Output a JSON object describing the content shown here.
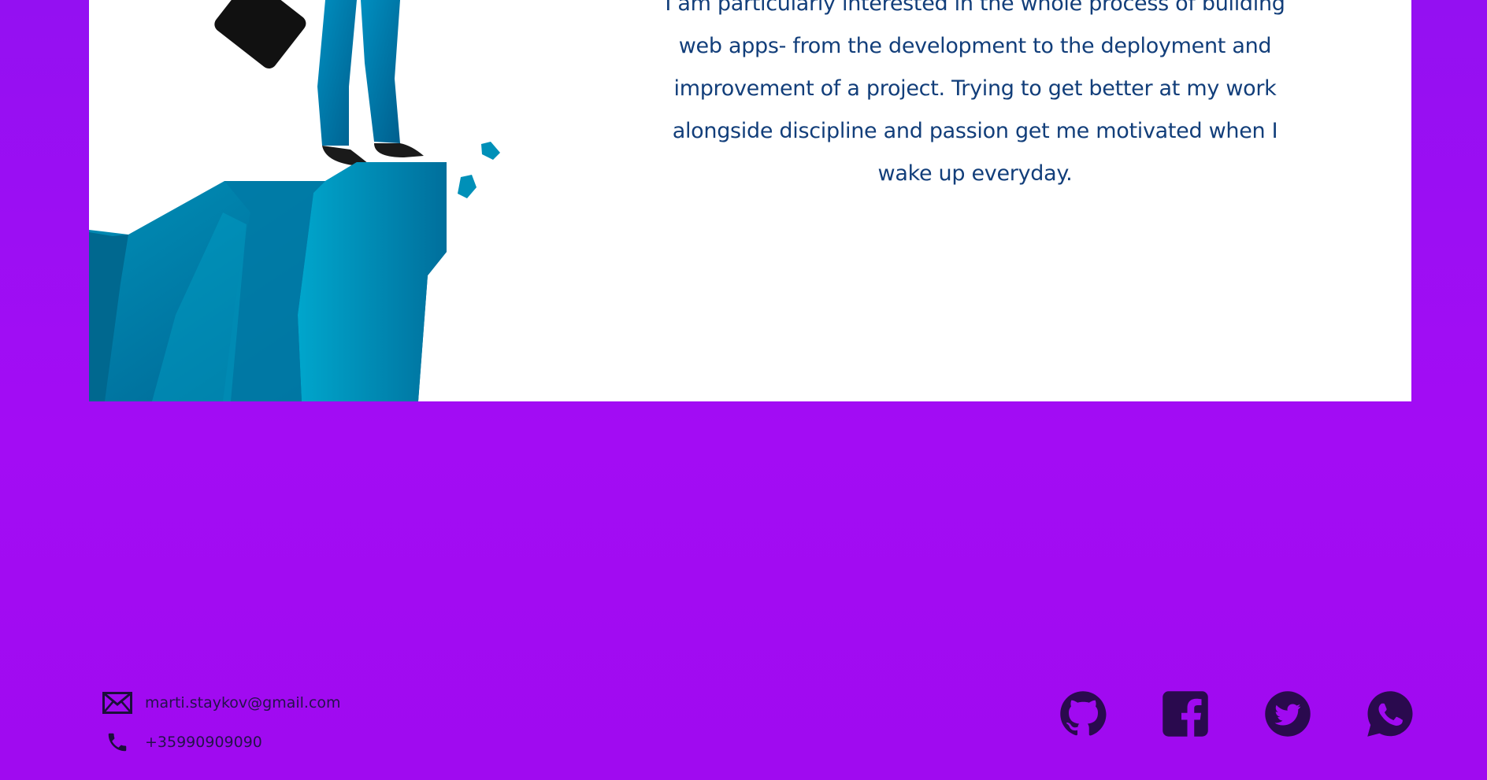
{
  "about": {
    "paragraph": "I am particularly interested in the whole process of building web apps- from the development to the deployment and improvement of a project. Trying to get better at my work alongside discipline and passion get me motivated when I wake up everyday."
  },
  "contacts": {
    "email": {
      "icon": "envelope-icon",
      "value": "marti.staykov@gmail.com"
    },
    "phone": {
      "icon": "phone-icon",
      "value": "+35990909090"
    }
  },
  "socials": [
    {
      "name": "github",
      "icon": "github-icon"
    },
    {
      "name": "facebook",
      "icon": "facebook-icon"
    },
    {
      "name": "twitter",
      "icon": "twitter-icon"
    },
    {
      "name": "whatsapp",
      "icon": "whatsapp-icon"
    }
  ],
  "colors": {
    "background": "#9d0df3",
    "card": "#ffffff",
    "text_accent": "#123e7a",
    "footer_dark": "#2a0a4e"
  }
}
